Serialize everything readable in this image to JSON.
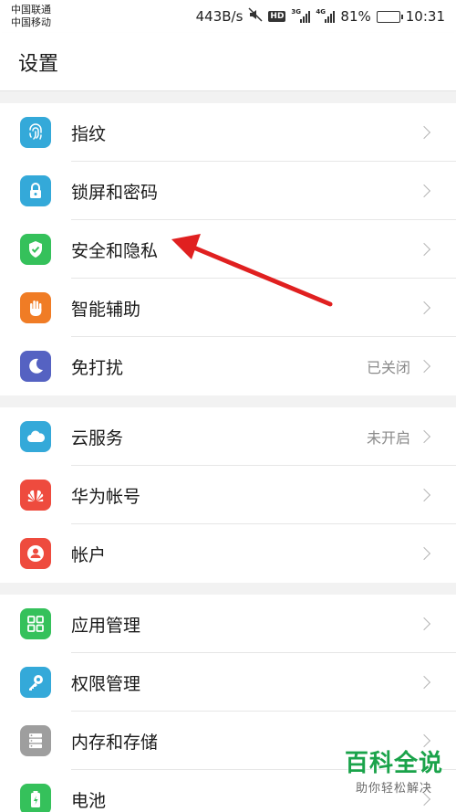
{
  "status_bar": {
    "carrier_1": "中国联通",
    "carrier_2": "中国移动",
    "speed": "443B/s",
    "hd": "HD",
    "sig1_tag": "3G",
    "sig2_tag": "4G",
    "battery_text": "81%",
    "battery_level": 0.81,
    "time": "10:31"
  },
  "header": {
    "title": "设置"
  },
  "groups": [
    {
      "items": [
        {
          "label": "指纹",
          "value": "",
          "icon": "fingerprint-icon",
          "color": "#34a9d9"
        },
        {
          "label": "锁屏和密码",
          "value": "",
          "icon": "lock-icon",
          "color": "#34a9d9"
        },
        {
          "label": "安全和隐私",
          "value": "",
          "icon": "shield-check-icon",
          "color": "#35c15b"
        },
        {
          "label": "智能辅助",
          "value": "",
          "icon": "hand-icon",
          "color": "#f07c25"
        },
        {
          "label": "免打扰",
          "value": "已关闭",
          "icon": "moon-icon",
          "color": "#5562c2"
        }
      ]
    },
    {
      "items": [
        {
          "label": "云服务",
          "value": "未开启",
          "icon": "cloud-icon",
          "color": "#34a9d9"
        },
        {
          "label": "华为帐号",
          "value": "",
          "icon": "huawei-logo-icon",
          "color": "#ee4b3e"
        },
        {
          "label": "帐户",
          "value": "",
          "icon": "person-icon",
          "color": "#ee4b3e"
        }
      ]
    },
    {
      "items": [
        {
          "label": "应用管理",
          "value": "",
          "icon": "apps-grid-icon",
          "color": "#35c15b"
        },
        {
          "label": "权限管理",
          "value": "",
          "icon": "key-icon",
          "color": "#34a9d9"
        },
        {
          "label": "内存和存储",
          "value": "",
          "icon": "storage-icon",
          "color": "#9e9e9e"
        },
        {
          "label": "电池",
          "value": "",
          "icon": "battery-icon",
          "color": "#35c15b"
        }
      ]
    }
  ],
  "watermark": {
    "title": "百科全说",
    "subtitle": "助你轻松解决"
  }
}
